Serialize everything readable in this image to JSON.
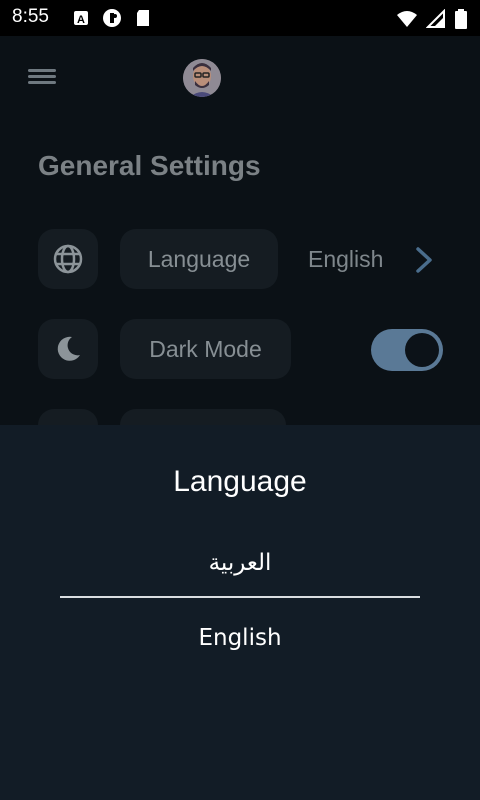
{
  "status_bar": {
    "time": "8:55",
    "left_icons": [
      "a-box-icon",
      "status-circle-icon",
      "sd-card-icon"
    ],
    "right_icons": [
      "wifi-icon",
      "signal-icon",
      "battery-icon"
    ]
  },
  "header": {
    "menu_icon": "hamburger-menu-icon",
    "avatar": "user-avatar"
  },
  "settings": {
    "title": "General Settings",
    "rows": [
      {
        "icon": "globe-icon",
        "label": "Language",
        "value": "English",
        "action_icon": "chevron-right-icon"
      },
      {
        "icon": "moon-icon",
        "label": "Dark Mode",
        "toggle_on": true
      }
    ]
  },
  "language_sheet": {
    "title": "Language",
    "options": [
      "العربية",
      "English"
    ]
  },
  "colors": {
    "background": "#0b1116",
    "sheet": "#121c26",
    "accent": "#5a7996",
    "tile": "#151c22"
  }
}
